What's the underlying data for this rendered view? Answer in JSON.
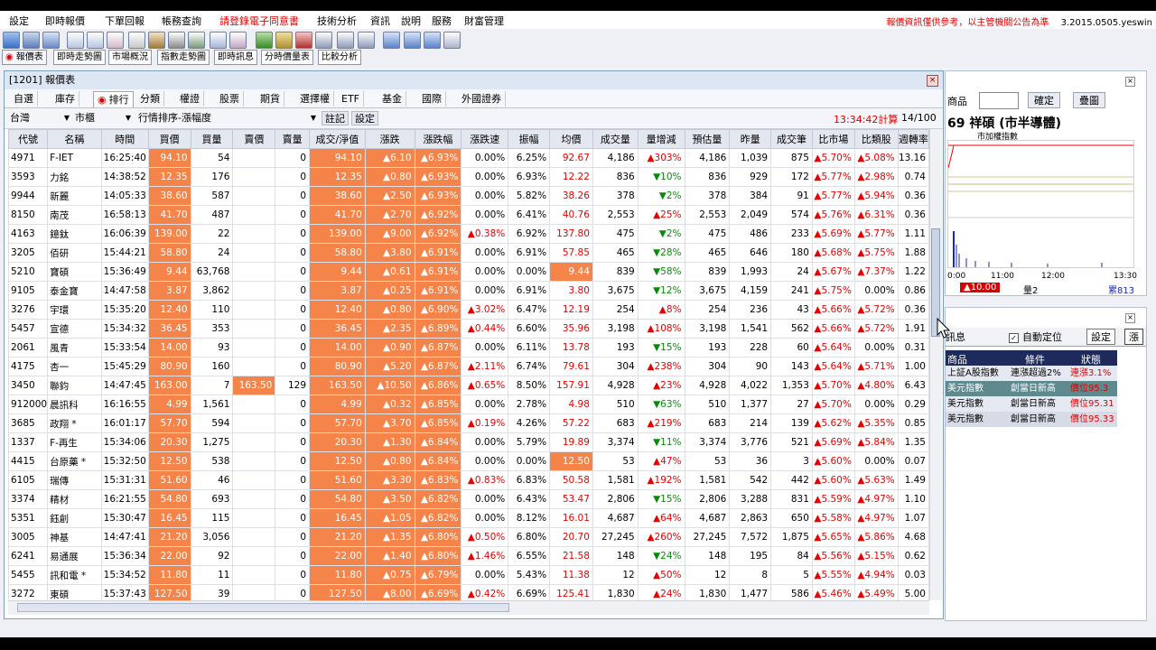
{
  "menu": {
    "items": [
      "設定",
      "即時報價",
      "下單回報",
      "帳務查詢",
      "請登錄電子同意書",
      "技術分析",
      "資訊",
      "說明",
      "服務",
      "財富管理"
    ],
    "highlight_index": 4,
    "notice": "報價資訊僅供參考，以主管機關公告為準",
    "version": "3.2015.0505.yeswin"
  },
  "toolbar_tabs": [
    {
      "label": "報價表",
      "active": true
    },
    {
      "label": "即時走勢圖",
      "active": false
    },
    {
      "label": "市場概況",
      "active": false
    },
    {
      "label": "指數走勢圖",
      "active": false
    },
    {
      "label": "即時訊息",
      "active": false
    },
    {
      "label": "分時價量表",
      "active": false
    },
    {
      "label": "比較分析",
      "active": false
    }
  ],
  "quote_window": {
    "title": "[1201] 報價表",
    "tabs": [
      "自選",
      "庫存",
      "排行",
      "分類",
      "權證",
      "股票",
      "期貨",
      "選擇權",
      "ETF",
      "基金",
      "國際",
      "外國證券"
    ],
    "active_tab": "排行",
    "filter": {
      "market": "台灣",
      "board": "市櫃",
      "sort": "行情排序-漲幅度",
      "note_button": "註記",
      "settings_button": "設定",
      "calc_time": "13:34:42計算",
      "page": "14/100"
    },
    "columns": [
      "代號",
      "名稱",
      "時間",
      "買價",
      "買量",
      "賣價",
      "賣量",
      "成交/淨值",
      "漲跌",
      "漲跌幅",
      "漲跌速",
      "振幅",
      "均價",
      "成交量",
      "量增減",
      "預估量",
      "昨量",
      "成交筆",
      "比市場",
      "比類股",
      "週轉率"
    ],
    "rows": [
      [
        "4971",
        "F-IET",
        "16:25:40",
        "94.10",
        "54",
        "",
        "0",
        "94.10",
        "▲6.10",
        "▲6.93%",
        "0.00%",
        "6.25%",
        "92.67",
        "4,186",
        "▲303%",
        "4,186",
        "1,039",
        "875",
        "▲5.70%",
        "▲5.08%",
        "13.16"
      ],
      [
        "3593",
        "力銘",
        "14:38:52",
        "12.35",
        "176",
        "",
        "0",
        "12.35",
        "▲0.80",
        "▲6.93%",
        "0.00%",
        "6.93%",
        "12.22",
        "836",
        "▼10%",
        "836",
        "929",
        "172",
        "▲5.77%",
        "▲2.98%",
        "0.74"
      ],
      [
        "9944",
        "新麗",
        "14:05:33",
        "38.60",
        "587",
        "",
        "0",
        "38.60",
        "▲2.50",
        "▲6.93%",
        "0.00%",
        "5.82%",
        "38.26",
        "378",
        "▼2%",
        "378",
        "384",
        "91",
        "▲5.77%",
        "▲5.94%",
        "0.36"
      ],
      [
        "8150",
        "南茂",
        "16:58:13",
        "41.70",
        "487",
        "",
        "0",
        "41.70",
        "▲2.70",
        "▲6.92%",
        "0.00%",
        "6.41%",
        "40.76",
        "2,553",
        "▲25%",
        "2,553",
        "2,049",
        "574",
        "▲5.76%",
        "▲6.31%",
        "0.36"
      ],
      [
        "4163",
        "鐿鈦",
        "16:06:39",
        "139.00",
        "22",
        "",
        "0",
        "139.00",
        "▲9.00",
        "▲6.92%",
        "▲0.38%",
        "6.92%",
        "137.80",
        "475",
        "▼2%",
        "475",
        "486",
        "233",
        "▲5.69%",
        "▲5.77%",
        "1.11"
      ],
      [
        "3205",
        "佰研",
        "15:44:21",
        "58.80",
        "24",
        "",
        "0",
        "58.80",
        "▲3.80",
        "▲6.91%",
        "0.00%",
        "6.91%",
        "57.85",
        "465",
        "▼28%",
        "465",
        "646",
        "180",
        "▲5.68%",
        "▲5.75%",
        "1.88"
      ],
      [
        "5210",
        "寶碩",
        "15:36:49",
        "9.44",
        "63,768",
        "",
        "0",
        "9.44",
        "▲0.61",
        "▲6.91%",
        "0.00%",
        "0.00%",
        "9.44",
        "839",
        "▼58%",
        "839",
        "1,993",
        "24",
        "▲5.67%",
        "▲7.37%",
        "1.22"
      ],
      [
        "9105",
        "泰金寶",
        "14:47:58",
        "3.87",
        "3,862",
        "",
        "0",
        "3.87",
        "▲0.25",
        "▲6.91%",
        "0.00%",
        "6.91%",
        "3.80",
        "3,675",
        "▼12%",
        "3,675",
        "4,159",
        "241",
        "▲5.75%",
        "0.00%",
        "0.86"
      ],
      [
        "3276",
        "宇環",
        "15:35:20",
        "12.40",
        "110",
        "",
        "0",
        "12.40",
        "▲0.80",
        "▲6.90%",
        "▲3.02%",
        "6.47%",
        "12.19",
        "254",
        "▲8%",
        "254",
        "236",
        "43",
        "▲5.66%",
        "▲5.72%",
        "0.36"
      ],
      [
        "5457",
        "宣德",
        "15:34:32",
        "36.45",
        "353",
        "",
        "0",
        "36.45",
        "▲2.35",
        "▲6.89%",
        "▲0.44%",
        "6.60%",
        "35.96",
        "3,198",
        "▲108%",
        "3,198",
        "1,541",
        "562",
        "▲5.66%",
        "▲5.72%",
        "1.91"
      ],
      [
        "2061",
        "風青",
        "15:33:54",
        "14.00",
        "93",
        "",
        "0",
        "14.00",
        "▲0.90",
        "▲6.87%",
        "0.00%",
        "6.11%",
        "13.78",
        "193",
        "▼15%",
        "193",
        "228",
        "60",
        "▲5.64%",
        "0.00%",
        "0.31"
      ],
      [
        "4175",
        "杏一",
        "15:45:29",
        "80.90",
        "160",
        "",
        "0",
        "80.90",
        "▲5.20",
        "▲6.87%",
        "▲2.11%",
        "6.74%",
        "79.61",
        "304",
        "▲238%",
        "304",
        "90",
        "143",
        "▲5.64%",
        "▲5.71%",
        "1.00"
      ],
      [
        "3450",
        "聯鈞",
        "14:47:45",
        "163.00",
        "7",
        "163.50",
        "129",
        "163.50",
        "▲10.50",
        "▲6.86%",
        "▲0.65%",
        "8.50%",
        "157.91",
        "4,928",
        "▲23%",
        "4,928",
        "4,022",
        "1,353",
        "▲5.70%",
        "▲4.80%",
        "6.43"
      ],
      [
        "912000",
        "晨訊科",
        "16:16:55",
        "4.99",
        "1,561",
        "",
        "0",
        "4.99",
        "▲0.32",
        "▲6.85%",
        "0.00%",
        "2.78%",
        "4.98",
        "510",
        "▼63%",
        "510",
        "1,377",
        "27",
        "▲5.70%",
        "0.00%",
        "0.29"
      ],
      [
        "3685",
        "政翔 *",
        "16:01:17",
        "57.70",
        "594",
        "",
        "0",
        "57.70",
        "▲3.70",
        "▲6.85%",
        "▲0.19%",
        "4.26%",
        "57.22",
        "683",
        "▲219%",
        "683",
        "214",
        "139",
        "▲5.62%",
        "▲5.35%",
        "0.85"
      ],
      [
        "1337",
        "F-再生",
        "15:34:06",
        "20.30",
        "1,275",
        "",
        "0",
        "20.30",
        "▲1.30",
        "▲6.84%",
        "0.00%",
        "5.79%",
        "19.89",
        "3,374",
        "▼11%",
        "3,374",
        "3,776",
        "521",
        "▲5.69%",
        "▲5.84%",
        "1.35"
      ],
      [
        "4415",
        "台原藥 *",
        "15:32:50",
        "12.50",
        "538",
        "",
        "0",
        "12.50",
        "▲0.80",
        "▲6.84%",
        "0.00%",
        "0.00%",
        "12.50",
        "53",
        "▲47%",
        "53",
        "36",
        "3",
        "▲5.60%",
        "0.00%",
        "0.07"
      ],
      [
        "6105",
        "瑞傳",
        "15:31:31",
        "51.60",
        "46",
        "",
        "0",
        "51.60",
        "▲3.30",
        "▲6.83%",
        "▲0.83%",
        "6.83%",
        "50.58",
        "1,581",
        "▲192%",
        "1,581",
        "542",
        "442",
        "▲5.60%",
        "▲5.63%",
        "1.49"
      ],
      [
        "3374",
        "精材",
        "16:21:55",
        "54.80",
        "693",
        "",
        "0",
        "54.80",
        "▲3.50",
        "▲6.82%",
        "0.00%",
        "6.43%",
        "53.47",
        "2,806",
        "▼15%",
        "2,806",
        "3,288",
        "831",
        "▲5.59%",
        "▲4.97%",
        "1.10"
      ],
      [
        "5351",
        "鈺創",
        "15:30:47",
        "16.45",
        "115",
        "",
        "0",
        "16.45",
        "▲1.05",
        "▲6.82%",
        "0.00%",
        "8.12%",
        "16.01",
        "4,687",
        "▲64%",
        "4,687",
        "2,863",
        "650",
        "▲5.58%",
        "▲4.97%",
        "1.07"
      ],
      [
        "3005",
        "神基",
        "14:47:41",
        "21.20",
        "3,056",
        "",
        "0",
        "21.20",
        "▲1.35",
        "▲6.80%",
        "▲0.50%",
        "6.80%",
        "20.70",
        "27,245",
        "▲260%",
        "27,245",
        "7,572",
        "1,875",
        "▲5.65%",
        "▲5.86%",
        "4.68"
      ],
      [
        "6241",
        "易通展",
        "15:36:34",
        "22.00",
        "92",
        "",
        "0",
        "22.00",
        "▲1.40",
        "▲6.80%",
        "▲1.46%",
        "6.55%",
        "21.58",
        "148",
        "▼24%",
        "148",
        "195",
        "84",
        "▲5.56%",
        "▲5.15%",
        "0.62"
      ],
      [
        "5455",
        "訊和電 *",
        "15:34:52",
        "11.80",
        "11",
        "",
        "0",
        "11.80",
        "▲0.75",
        "▲6.79%",
        "0.00%",
        "5.43%",
        "11.38",
        "12",
        "▲50%",
        "12",
        "8",
        "5",
        "▲5.55%",
        "▲4.94%",
        "0.03"
      ],
      [
        "3272",
        "東碩",
        "15:37:43",
        "127.50",
        "39",
        "",
        "0",
        "127.50",
        "▲8.00",
        "▲6.69%",
        "▲0.42%",
        "6.69%",
        "125.41",
        "1,830",
        "▲24%",
        "1,830",
        "1,477",
        "586",
        "▲5.46%",
        "▲5.49%",
        "5.00"
      ]
    ]
  },
  "chart_window": {
    "label_product": "商品",
    "confirm_button": "確定",
    "overlay_button": "疊圖",
    "stock_name": "69 祥碩 (市半導體)",
    "subtitle": "市加權指數",
    "times": [
      "0:00",
      "11:00",
      "12:00",
      "13:30"
    ],
    "footer_change": "▲10.00",
    "footer_volume": "量2",
    "footer_total": "累813"
  },
  "alert_window": {
    "tab_partial": "訊息",
    "auto_locate_label": "自動定位",
    "settings_button": "設定",
    "tab_right": "漲",
    "headers": [
      "商品",
      "條件",
      "狀態"
    ],
    "rows": [
      {
        "product": "上証A股指數",
        "condition": "連漲超過2%",
        "status": "連漲3.1%"
      },
      {
        "product": "美元指數",
        "condition": "創當日新高",
        "status": "價位95.3"
      },
      {
        "product": "美元指數",
        "condition": "創當日新高",
        "status": "價位95.31"
      },
      {
        "product": "美元指數",
        "condition": "創當日新高",
        "status": "價位95.33"
      }
    ]
  },
  "colors": {
    "accent_orange": "#f5844a",
    "up_red": "#e60000",
    "down_green": "#0a8a0a",
    "header_navy": "#1e2a5c"
  }
}
